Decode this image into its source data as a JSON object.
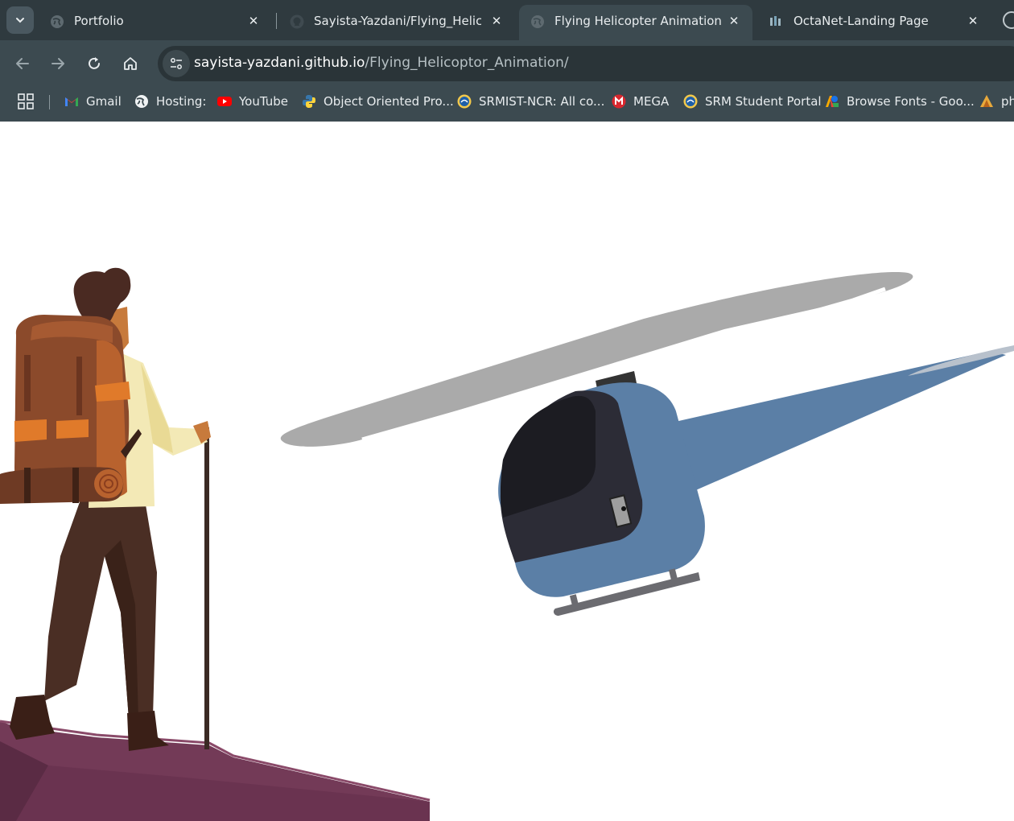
{
  "tabs": [
    {
      "title": "Portfolio",
      "active": false
    },
    {
      "title": "Sayista-Yazdani/Flying_Helicopt",
      "active": false
    },
    {
      "title": "Flying Helicopter Animation",
      "active": true
    },
    {
      "title": "OctaNet-Landing Page",
      "active": false
    }
  ],
  "address": {
    "host": "sayista-yazdani.github.io",
    "path": "/Flying_Helicoptor_Animation/"
  },
  "bookmarks": [
    {
      "label": "Gmail",
      "icon": "gmail-icon"
    },
    {
      "label": "Hosting:",
      "icon": "globe-icon"
    },
    {
      "label": "YouTube",
      "icon": "youtube-icon"
    },
    {
      "label": "Object Oriented Pro...",
      "icon": "python-icon"
    },
    {
      "label": "SRMIST-NCR: All co...",
      "icon": "srm-icon"
    },
    {
      "label": "MEGA",
      "icon": "mega-icon"
    },
    {
      "label": "SRM Student Portal",
      "icon": "srm-icon"
    },
    {
      "label": "Browse Fonts - Goo...",
      "icon": "google-fonts-icon"
    },
    {
      "label": "ph",
      "icon": "phdr-icon"
    }
  ],
  "colors": {
    "tab_strip": "#2f3a3f",
    "toolbar": "#3c4a50",
    "helicopter_body": "#5b7fa6",
    "helicopter_cockpit": "#2c2c36",
    "rotor_blur": "#a9a9a9",
    "cliff": "#733a57"
  }
}
